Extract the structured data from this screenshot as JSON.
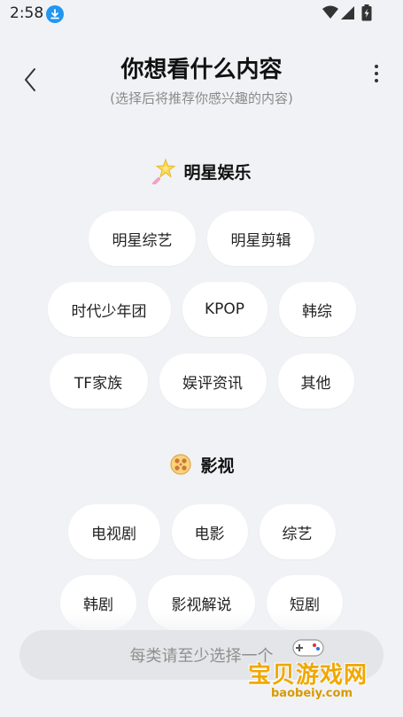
{
  "status": {
    "time": "2:58"
  },
  "header": {
    "title": "你想看什么内容",
    "subtitle": "(选择后将推荐你感兴趣的内容)"
  },
  "sections": [
    {
      "title": "明星娱乐",
      "icon": "star-wand-icon",
      "rows": [
        [
          "明星综艺",
          "明星剪辑"
        ],
        [
          "时代少年团",
          "KPOP",
          "韩综"
        ],
        [
          "TF家族",
          "娱评资讯",
          "其他"
        ]
      ]
    },
    {
      "title": "影视",
      "icon": "film-reel-icon",
      "rows": [
        [
          "电视剧",
          "电影",
          "综艺"
        ],
        [
          "韩剧",
          "影视解说",
          "短剧"
        ]
      ]
    }
  ],
  "footer": {
    "submit_label": "每类请至少选择一个"
  },
  "watermark": {
    "text": "宝贝游戏网",
    "url": "baobeiy.com"
  },
  "colors": {
    "background": "#f1f2f5",
    "chip": "#ffffff",
    "download_badge": "#2196f3",
    "watermark": "#f0a800"
  }
}
